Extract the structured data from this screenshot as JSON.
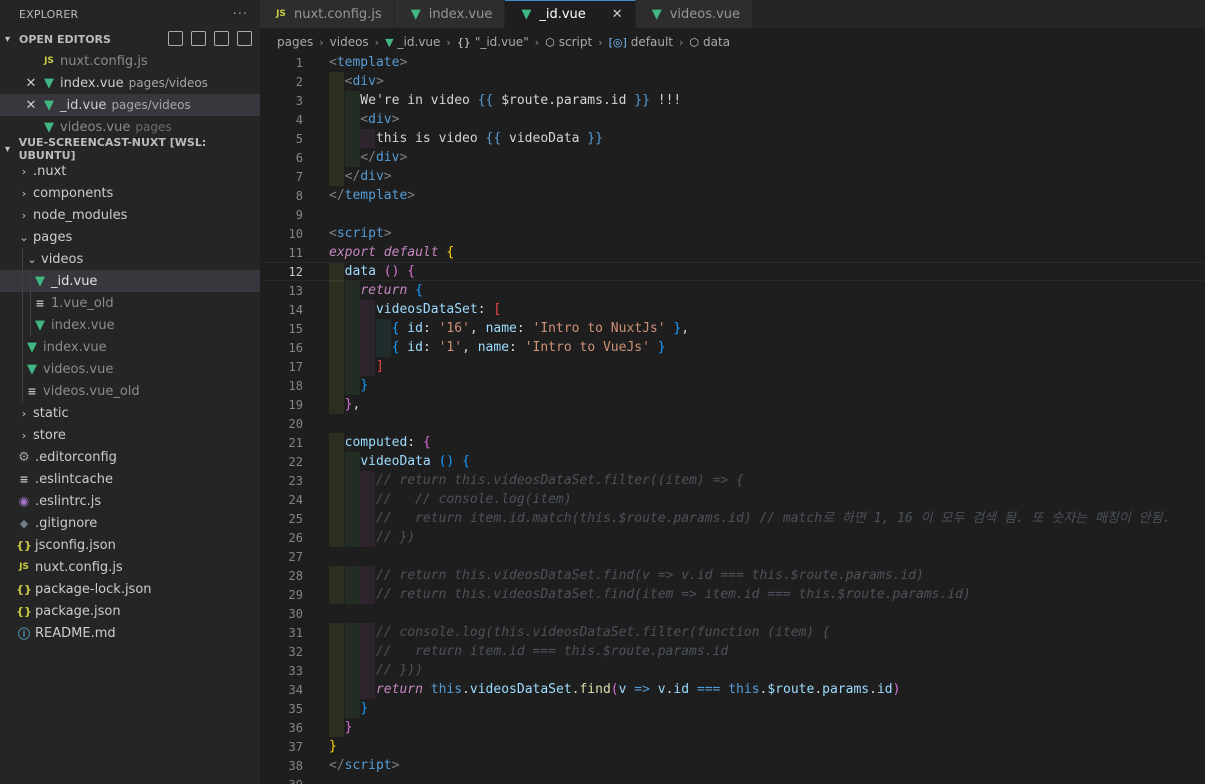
{
  "sidebar": {
    "title": "EXPLORER",
    "more": "···",
    "open_editors_title": "OPEN EDITORS",
    "open_editors": [
      {
        "name": "nuxt.config.js",
        "desc": "",
        "icon": "js-icon",
        "dim": true,
        "close": false
      },
      {
        "name": "index.vue",
        "desc": "pages/videos",
        "icon": "vue-icon",
        "dim": false,
        "close": true
      },
      {
        "name": "_id.vue",
        "desc": "pages/videos",
        "icon": "vue-icon",
        "dim": false,
        "close": true,
        "active": true
      },
      {
        "name": "videos.vue",
        "desc": "pages",
        "icon": "vue-icon",
        "dim": true,
        "close": false
      }
    ],
    "workspace_title": "VUE-SCREENCAST-NUXT [WSL: UBUNTU]",
    "tree": [
      {
        "name": ".nuxt",
        "type": "folder",
        "expanded": false,
        "depth": 0
      },
      {
        "name": "components",
        "type": "folder",
        "expanded": false,
        "depth": 0
      },
      {
        "name": "node_modules",
        "type": "folder",
        "expanded": false,
        "depth": 0
      },
      {
        "name": "pages",
        "type": "folder",
        "expanded": true,
        "depth": 0
      },
      {
        "name": "videos",
        "type": "folder",
        "expanded": true,
        "depth": 1
      },
      {
        "name": "_id.vue",
        "type": "vue",
        "depth": 2,
        "active": true
      },
      {
        "name": "1.vue_old",
        "type": "lines",
        "depth": 2,
        "dim": true
      },
      {
        "name": "index.vue",
        "type": "vue",
        "depth": 2,
        "dim": true
      },
      {
        "name": "index.vue",
        "type": "vue",
        "depth": 1,
        "dim": true
      },
      {
        "name": "videos.vue",
        "type": "vue",
        "depth": 1,
        "dim": true
      },
      {
        "name": "videos.vue_old",
        "type": "lines",
        "depth": 1,
        "dim": true
      },
      {
        "name": "static",
        "type": "folder",
        "expanded": false,
        "depth": 0
      },
      {
        "name": "store",
        "type": "folder",
        "expanded": false,
        "depth": 0
      },
      {
        "name": ".editorconfig",
        "type": "gear",
        "depth": 0
      },
      {
        "name": ".eslintcache",
        "type": "lines",
        "depth": 0
      },
      {
        "name": ".eslintrc.js",
        "type": "eslint",
        "depth": 0
      },
      {
        "name": ".gitignore",
        "type": "git",
        "depth": 0
      },
      {
        "name": "jsconfig.json",
        "type": "json",
        "depth": 0
      },
      {
        "name": "nuxt.config.js",
        "type": "js",
        "depth": 0
      },
      {
        "name": "package-lock.json",
        "type": "json",
        "depth": 0
      },
      {
        "name": "package.json",
        "type": "json",
        "depth": 0
      },
      {
        "name": "README.md",
        "type": "info",
        "depth": 0
      }
    ]
  },
  "tabs": [
    {
      "label": "nuxt.config.js",
      "icon": "js-icon",
      "active": false
    },
    {
      "label": "index.vue",
      "icon": "vue-icon",
      "active": false
    },
    {
      "label": "_id.vue",
      "icon": "vue-icon",
      "active": true,
      "close": "✕"
    },
    {
      "label": "videos.vue",
      "icon": "vue-icon",
      "active": false
    }
  ],
  "breadcrumbs": {
    "items": [
      "pages",
      "videos",
      "_id.vue",
      "\"_id.vue\"",
      "script",
      "default",
      "data"
    ],
    "icons": [
      "",
      "",
      "vue-icon",
      "braces-icon",
      "cube-icon",
      "variable-icon",
      "cube-icon"
    ],
    "icon_glyphs": [
      "",
      "",
      "▼",
      "{}",
      "⬡",
      "[◎]",
      "⬡"
    ]
  },
  "editor": {
    "current_line": 12,
    "lines": [
      [
        [
          "t-br",
          "<"
        ],
        [
          "t-tag",
          "template"
        ],
        [
          "t-br",
          ">"
        ]
      ],
      [
        [
          "t-br",
          "  <"
        ],
        [
          "t-tag",
          "div"
        ],
        [
          "t-br",
          ">"
        ]
      ],
      [
        [
          "t-txt",
          "    We're in video "
        ],
        [
          "t-int",
          "{{"
        ],
        [
          "t-txt",
          " $route.params.id "
        ],
        [
          "t-int",
          "}}"
        ],
        [
          "t-txt",
          " !!!"
        ]
      ],
      [
        [
          "t-br",
          "    <"
        ],
        [
          "t-tag",
          "div"
        ],
        [
          "t-br",
          ">"
        ]
      ],
      [
        [
          "t-txt",
          "      this is video "
        ],
        [
          "t-int",
          "{{"
        ],
        [
          "t-txt",
          " videoData "
        ],
        [
          "t-int",
          "}}"
        ]
      ],
      [
        [
          "t-br",
          "    </"
        ],
        [
          "t-tag",
          "div"
        ],
        [
          "t-br",
          ">"
        ]
      ],
      [
        [
          "t-br",
          "  </"
        ],
        [
          "t-tag",
          "div"
        ],
        [
          "t-br",
          ">"
        ]
      ],
      [
        [
          "t-br",
          "</"
        ],
        [
          "t-tag",
          "template"
        ],
        [
          "t-br",
          ">"
        ]
      ],
      [],
      [
        [
          "t-br",
          "<"
        ],
        [
          "t-tag",
          "script"
        ],
        [
          "t-br",
          ">"
        ]
      ],
      [
        [
          "t-kw",
          "export"
        ],
        [
          "t-op",
          " "
        ],
        [
          "t-kw",
          "default"
        ],
        [
          "t-op",
          " "
        ],
        [
          "t-brk1",
          "{"
        ]
      ],
      [
        [
          "t-op",
          "  "
        ],
        [
          "t-prop",
          "data"
        ],
        [
          "t-op",
          " "
        ],
        [
          "t-brk2",
          "()"
        ],
        [
          "t-op",
          " "
        ],
        [
          "t-brk2",
          "{"
        ]
      ],
      [
        [
          "t-op",
          "    "
        ],
        [
          "t-kw",
          "return"
        ],
        [
          "t-op",
          " "
        ],
        [
          "t-brk3",
          "{"
        ]
      ],
      [
        [
          "t-op",
          "      "
        ],
        [
          "t-prop",
          "videosDataSet"
        ],
        [
          "t-op",
          ": "
        ],
        [
          "t-red",
          "["
        ]
      ],
      [
        [
          "t-op",
          "        "
        ],
        [
          "t-brk3",
          "{"
        ],
        [
          "t-op",
          " "
        ],
        [
          "t-prop",
          "id"
        ],
        [
          "t-op",
          ": "
        ],
        [
          "t-str",
          "'16'"
        ],
        [
          "t-op",
          ", "
        ],
        [
          "t-prop",
          "name"
        ],
        [
          "t-op",
          ": "
        ],
        [
          "t-str",
          "'Intro to NuxtJs'"
        ],
        [
          "t-op",
          " "
        ],
        [
          "t-brk3",
          "}"
        ],
        [
          "t-op",
          ","
        ]
      ],
      [
        [
          "t-op",
          "        "
        ],
        [
          "t-brk3",
          "{"
        ],
        [
          "t-op",
          " "
        ],
        [
          "t-prop",
          "id"
        ],
        [
          "t-op",
          ": "
        ],
        [
          "t-str",
          "'1'"
        ],
        [
          "t-op",
          ", "
        ],
        [
          "t-prop",
          "name"
        ],
        [
          "t-op",
          ": "
        ],
        [
          "t-str",
          "'Intro to VueJs'"
        ],
        [
          "t-op",
          " "
        ],
        [
          "t-brk3",
          "}"
        ]
      ],
      [
        [
          "t-op",
          "      "
        ],
        [
          "t-red",
          "]"
        ]
      ],
      [
        [
          "t-op",
          "    "
        ],
        [
          "t-brk3",
          "}"
        ]
      ],
      [
        [
          "t-op",
          "  "
        ],
        [
          "t-brk2",
          "}"
        ],
        [
          "t-op",
          ","
        ]
      ],
      [],
      [
        [
          "t-op",
          "  "
        ],
        [
          "t-prop",
          "computed"
        ],
        [
          "t-op",
          ": "
        ],
        [
          "t-brk2",
          "{"
        ]
      ],
      [
        [
          "t-op",
          "    "
        ],
        [
          "t-prop",
          "videoData"
        ],
        [
          "t-op",
          " "
        ],
        [
          "t-brk3",
          "()"
        ],
        [
          "t-op",
          " "
        ],
        [
          "t-brk3",
          "{"
        ]
      ],
      [
        [
          "t-op",
          "      "
        ],
        [
          "t-com",
          "// return this.videosDataSet.filter((item) => {"
        ]
      ],
      [
        [
          "t-op",
          "      "
        ],
        [
          "t-com",
          "//   // console.log(item)"
        ]
      ],
      [
        [
          "t-op",
          "      "
        ],
        [
          "t-com",
          "//   return item.id.match(this.$route.params.id) // match로 하면 1, 16 이 모두 검색 됨. 또 숫자는 매칭이 안됨."
        ]
      ],
      [
        [
          "t-op",
          "      "
        ],
        [
          "t-com",
          "// })"
        ]
      ],
      [],
      [
        [
          "t-op",
          "      "
        ],
        [
          "t-com",
          "// return this.videosDataSet.find(v => v.id === this.$route.params.id)"
        ]
      ],
      [
        [
          "t-op",
          "      "
        ],
        [
          "t-com",
          "// return this.videosDataSet.find(item => item.id === this.$route.params.id)"
        ]
      ],
      [],
      [
        [
          "t-op",
          "      "
        ],
        [
          "t-com",
          "// console.log(this.videosDataSet.filter(function (item) {"
        ]
      ],
      [
        [
          "t-op",
          "      "
        ],
        [
          "t-com",
          "//   return item.id === this.$route.params.id"
        ]
      ],
      [
        [
          "t-op",
          "      "
        ],
        [
          "t-com",
          "// }))"
        ]
      ],
      [
        [
          "t-op",
          "      "
        ],
        [
          "t-kw",
          "return"
        ],
        [
          "t-op",
          " "
        ],
        [
          "t-int",
          "this"
        ],
        [
          "t-op",
          "."
        ],
        [
          "t-prop",
          "videosDataSet"
        ],
        [
          "t-op",
          "."
        ],
        [
          "t-fn",
          "find"
        ],
        [
          "t-brk2",
          "("
        ],
        [
          "t-prop",
          "v"
        ],
        [
          "t-op",
          " "
        ],
        [
          "t-int",
          "=>"
        ],
        [
          "t-op",
          " "
        ],
        [
          "t-prop",
          "v"
        ],
        [
          "t-op",
          "."
        ],
        [
          "t-prop",
          "id"
        ],
        [
          "t-op",
          " "
        ],
        [
          "t-int",
          "==="
        ],
        [
          "t-op",
          " "
        ],
        [
          "t-int",
          "this"
        ],
        [
          "t-op",
          "."
        ],
        [
          "t-prop",
          "$route"
        ],
        [
          "t-op",
          "."
        ],
        [
          "t-prop",
          "params"
        ],
        [
          "t-op",
          "."
        ],
        [
          "t-prop",
          "id"
        ],
        [
          "t-brk2",
          ")"
        ]
      ],
      [
        [
          "t-op",
          "    "
        ],
        [
          "t-brk3",
          "}"
        ]
      ],
      [
        [
          "t-op",
          "  "
        ],
        [
          "t-brk2",
          "}"
        ]
      ],
      [
        [
          "t-brk1",
          "}"
        ]
      ],
      [
        [
          "t-br",
          "</"
        ],
        [
          "t-tag",
          "script"
        ],
        [
          "t-br",
          ">"
        ]
      ],
      []
    ],
    "line_numbers": [
      "1",
      "2",
      "3",
      "4",
      "5",
      "6",
      "7",
      "8",
      "9",
      "10",
      "11",
      "12",
      "13",
      "14",
      "15",
      "16",
      "17",
      "18",
      "19",
      "20",
      "21",
      "22",
      "23",
      "24",
      "25",
      "26",
      "27",
      "28",
      "29",
      "30",
      "31",
      "32",
      "33",
      "34",
      "35",
      "36",
      "37",
      "38",
      "39"
    ]
  }
}
